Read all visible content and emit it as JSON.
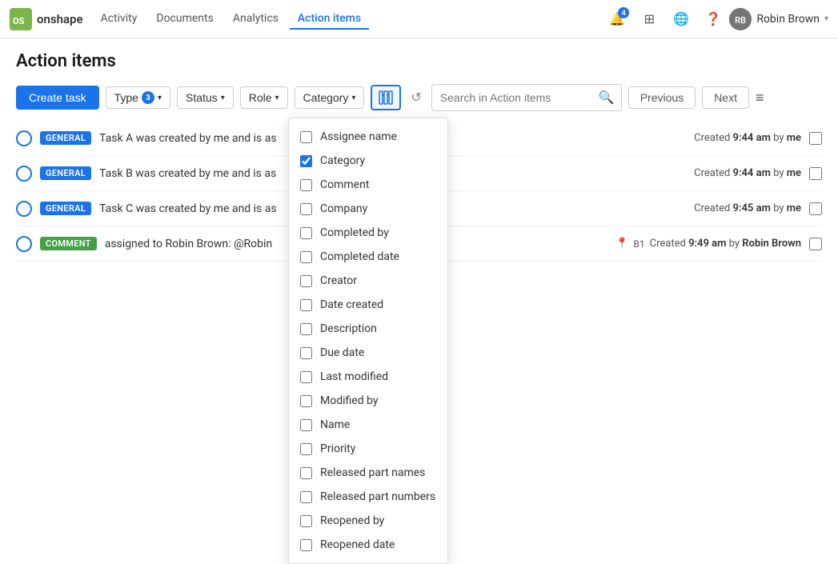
{
  "nav": {
    "logo_text": "onshape",
    "links": [
      {
        "label": "Activity",
        "active": false
      },
      {
        "label": "Documents",
        "active": false
      },
      {
        "label": "Analytics",
        "active": false
      },
      {
        "label": "Action items",
        "active": true
      }
    ],
    "notification_badge": "4",
    "user": {
      "name": "Robin Brown",
      "initials": "RB"
    }
  },
  "page": {
    "title": "Action items"
  },
  "toolbar": {
    "create_label": "Create task",
    "type_label": "Type",
    "type_badge": "3",
    "status_label": "Status",
    "role_label": "Role",
    "category_label": "Category",
    "search_placeholder": "Search in Action items",
    "prev_label": "Previous",
    "next_label": "Next"
  },
  "dropdown": {
    "items": [
      {
        "label": "Assignee name",
        "checked": false
      },
      {
        "label": "Category",
        "checked": true
      },
      {
        "label": "Comment",
        "checked": false
      },
      {
        "label": "Company",
        "checked": false
      },
      {
        "label": "Completed by",
        "checked": false
      },
      {
        "label": "Completed date",
        "checked": false
      },
      {
        "label": "Creator",
        "checked": false
      },
      {
        "label": "Date created",
        "checked": false
      },
      {
        "label": "Description",
        "checked": false
      },
      {
        "label": "Due date",
        "checked": false
      },
      {
        "label": "Last modified",
        "checked": false
      },
      {
        "label": "Modified by",
        "checked": false
      },
      {
        "label": "Name",
        "checked": false
      },
      {
        "label": "Priority",
        "checked": false
      },
      {
        "label": "Released part names",
        "checked": false
      },
      {
        "label": "Released part numbers",
        "checked": false
      },
      {
        "label": "Reopened by",
        "checked": false
      },
      {
        "label": "Reopened date",
        "checked": false
      }
    ]
  },
  "tasks": [
    {
      "tag": "GENERAL",
      "tag_type": "general",
      "text": "Task A was created by me and is as",
      "meta": "Created 9:44 am by me"
    },
    {
      "tag": "GENERAL",
      "tag_type": "general",
      "text": "Task B was created by me and is as",
      "meta": "Created 9:44 am by me"
    },
    {
      "tag": "GENERAL",
      "tag_type": "general",
      "text": "Task C was created by me and is as",
      "meta": "Created 9:45 am by me"
    },
    {
      "tag": "COMMENT",
      "tag_type": "comment",
      "text": "assigned to Robin Brown: @Robin",
      "meta": "Created 9:49 am by Robin Brown",
      "has_pin": true,
      "pin_label": "B1"
    }
  ]
}
